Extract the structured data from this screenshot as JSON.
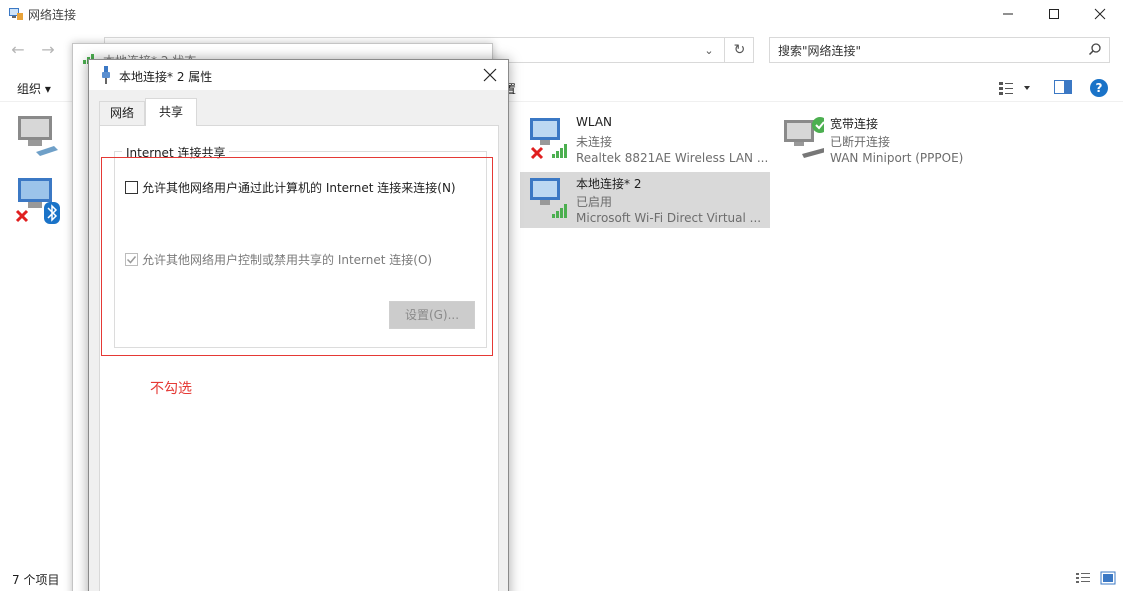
{
  "window": {
    "title": "网络连接",
    "search_placeholder": "搜索\"网络连接\""
  },
  "toolbar": {
    "organize_label": "组织 ▾",
    "partial_label": "置"
  },
  "connections": [
    {
      "name": "WLAN",
      "status": "未连接",
      "device": "Realtek 8821AE Wireless LAN ..."
    },
    {
      "name": "宽带连接",
      "status": "已断开连接",
      "device": "WAN Miniport (PPPOE)"
    },
    {
      "name": "本地连接* 2",
      "status": "已启用",
      "device": "Microsoft Wi-Fi Direct Virtual ..."
    }
  ],
  "statusbar": {
    "item_count": "7 个项目"
  },
  "status_window": {
    "title": "本地连接* 2 状态"
  },
  "properties_dialog": {
    "title": "本地连接* 2 属性",
    "tabs": [
      "网络",
      "共享"
    ],
    "active_tab": "共享",
    "group_title": "Internet 连接共享",
    "allow_connect_label": "允许其他网络用户通过此计算机的 Internet 连接来连接(N)",
    "allow_connect_checked": false,
    "allow_control_label": "允许其他网络用户控制或禁用共享的 Internet 连接(O)",
    "allow_control_checked": true,
    "settings_button": "设置(G)..."
  },
  "annotation": {
    "text": "不勾选",
    "color": "#e53935"
  },
  "colors": {
    "selection": "#d9d9d9",
    "accent": "#1a73c8"
  }
}
